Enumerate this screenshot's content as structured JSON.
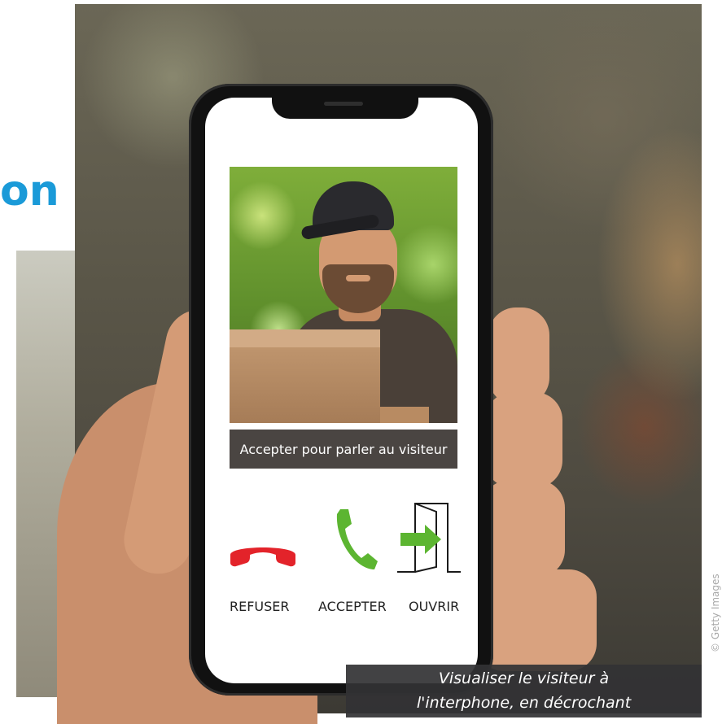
{
  "page": {
    "title_fragment": "on"
  },
  "screen": {
    "prompt": "Accepter pour parler au visiteur",
    "actions": [
      {
        "id": "refuse",
        "label": "REFUSER",
        "icon": "hang-up-icon",
        "color": "#e3232a"
      },
      {
        "id": "accept",
        "label": "ACCEPTER",
        "icon": "phone-icon",
        "color": "#5cb531"
      },
      {
        "id": "open",
        "label": "OUVRIR",
        "icon": "door-exit-icon",
        "color": "#5cb531"
      }
    ]
  },
  "caption": {
    "line1": "Visualiser le visiteur à",
    "line2": "l'interphone, en décrochant"
  },
  "credit": "© Getty Images",
  "colors": {
    "title": "#1a9ad8",
    "refuse": "#e3232a",
    "accept": "#5cb531",
    "prompt_bg": "#4a4542"
  }
}
